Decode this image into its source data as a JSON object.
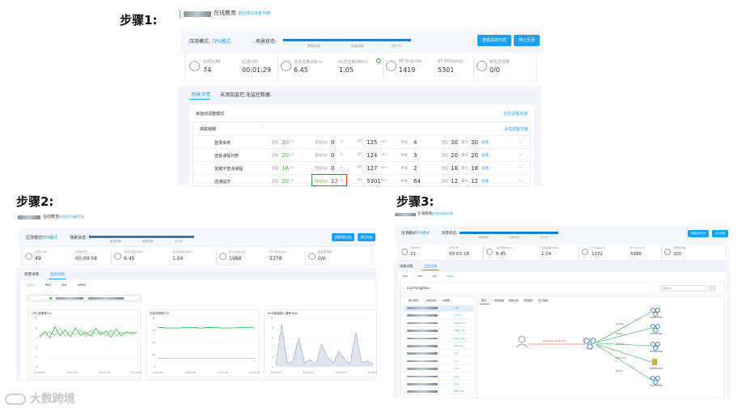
{
  "steps": {
    "s1": "步骤1:",
    "s2": "步骤2:",
    "s3": "步骤3:"
  },
  "header": {
    "title": "在线教育",
    "link": "返回测试场景列表"
  },
  "test": {
    "mode_label": "压测模式:",
    "mode_value": "TPS模式",
    "status_label": "场景状态:",
    "phases": [
      "数据准备",
      "链路调配",
      "执行中"
    ]
  },
  "buttons": {
    "log": "查看采样日志",
    "stop": "停止压测"
  },
  "metrics": {
    "s1": [
      {
        "label": "实时VUM",
        "value": "74"
      },
      {
        "label": "压测计时",
        "value": "00:01:29"
      },
      {
        "label": "请求流量(KB/s)",
        "value": "6.45"
      },
      {
        "label": "出流流量(MB/s)",
        "value": "1.05"
      },
      {
        "label": "RT Avg(ms)",
        "value": "1419"
      },
      {
        "label": "RT 90%(ms)",
        "value": "5301"
      },
      {
        "label": "新告异常数",
        "value": "0/0"
      }
    ],
    "s2": [
      {
        "label": "实时VUM",
        "value": "49"
      },
      {
        "label": "压测计时",
        "value": "00:00:58"
      },
      {
        "label": "请求流量(KB/s)",
        "value": "6.45"
      },
      {
        "label": "出流流量(MB/s)",
        "value": "1.04"
      },
      {
        "label": "RT Avg(ms)",
        "value": "1986"
      },
      {
        "label": "RT 90%(ms)",
        "value": "5378"
      },
      {
        "label": "新告异常数",
        "value": "0/0"
      }
    ],
    "s3": [
      {
        "label": "实时VUM",
        "value": "21"
      },
      {
        "label": "压测计时",
        "value": "00:03:18"
      },
      {
        "label": "请求流量(KB/s)",
        "value": "6.45"
      },
      {
        "label": "出流流量(MB/s)",
        "value": "1.04"
      },
      {
        "label": "RT Avg(ms)",
        "value": "1372"
      },
      {
        "label": "RT 90%(ms)",
        "value": "5380"
      },
      {
        "label": "新告异常数",
        "value": "0/0"
      }
    ]
  },
  "tabs1": {
    "details": "场景详情",
    "monitor": "未添加监控,无监控数据"
  },
  "section1": {
    "mode": "串自动调整模式",
    "global_link": "全局调整流速",
    "chain": "串联链路",
    "chain_link": "添加调整流速"
  },
  "rows": [
    {
      "name": "登录系统",
      "tps": "30",
      "err": "0",
      "rt": "125",
      "conc": "4",
      "now": "30",
      "max": "30",
      "act": "调速"
    },
    {
      "name": "查看课程列表",
      "tps": "20",
      "err": "0",
      "rt": "124",
      "conc": "3",
      "now": "20",
      "max": "20",
      "act": "调速"
    },
    {
      "name": "关键字查询课程",
      "tps": "18",
      "err": "0",
      "rt": "127",
      "conc": "2",
      "now": "18",
      "max": "18",
      "act": "调速"
    },
    {
      "name": "选课提交",
      "tps": "20",
      "err": "12",
      "rt": "5301",
      "conc": "64",
      "now": "12",
      "max": "12",
      "act": "调速"
    }
  ],
  "rowlabels": {
    "tps": "当前",
    "err": "错误tps",
    "rt": "RT",
    "conc": "并发",
    "now": "当前",
    "max": "最大",
    "unit_s": "/s",
    "unit_ms": "ms"
  },
  "tabs2": {
    "details": "场景详情",
    "monitor": "监控详情"
  },
  "subtabs2": [
    "ECS",
    "RDS",
    "SLB",
    "ARMS"
  ],
  "charts2": [
    {
      "title": "CPU 使用率(%)"
    },
    {
      "title": "内存利用率(%)"
    },
    {
      "title": "ph中磁盘读入速率 Bps"
    }
  ],
  "chart_data": [
    {
      "type": "line",
      "title": "CPU 使用率(%)",
      "x": [
        "14:38:00",
        "14:44:00",
        "14:50:00",
        "15:00:00"
      ],
      "ylim": [
        0,
        10
      ],
      "yticks": [
        "10",
        "8",
        "6",
        "4",
        "2",
        "0"
      ],
      "series": [
        {
          "values": [
            6.1,
            7.3,
            6.0,
            8.2,
            6.4,
            7.6,
            6.2,
            8.0,
            6.5,
            7.1,
            6.3,
            7.9,
            6.6,
            7.4,
            6.1,
            7.8,
            6.4,
            7.2,
            6.8,
            7.0
          ]
        },
        {
          "values": [
            6.4,
            6.8,
            7.2,
            6.5,
            7.9,
            6.3,
            7.4,
            6.6,
            7.7,
            6.2,
            7.5,
            6.7,
            7.3,
            6.4,
            7.6,
            6.5,
            7.1,
            6.8,
            7.2,
            6.9
          ]
        }
      ]
    },
    {
      "type": "line",
      "title": "内存利用率(%)",
      "x": [
        "14:38:00",
        "14:44:00",
        "14:50:00",
        "15:00:00"
      ],
      "ylim": [
        0,
        80
      ],
      "yticks": [
        "80",
        "60",
        "40",
        "20",
        "0"
      ],
      "series": [
        {
          "values": [
            65,
            64,
            64,
            65,
            64,
            65,
            64,
            64,
            65,
            64
          ]
        },
        {
          "values": [
            14,
            14,
            14,
            14,
            14,
            14,
            14,
            14,
            14,
            14
          ]
        }
      ]
    },
    {
      "type": "area",
      "title": "ph中磁盘读入速率 Bps",
      "x": [
        "14:38:00",
        "14:44:00",
        "14:50:00",
        "15:00:00"
      ],
      "ylim": [
        0,
        10
      ],
      "yticks": [
        "10",
        "8",
        "6",
        "4",
        "2",
        "0"
      ],
      "series": [
        {
          "values": [
            0.5,
            8.8,
            0.6,
            1.2,
            5.9,
            0.8,
            1.5,
            0.4,
            4.6,
            2.1,
            0.7,
            3.2,
            1.6,
            0.5,
            7.1,
            0.9,
            1.2,
            0.6
          ]
        }
      ]
    }
  ],
  "s3view": {
    "tabs": [
      "场景详情",
      "监控详情"
    ],
    "subtabs": [
      "ECS",
      "RDS",
      "SLB",
      "ARMS"
    ],
    "app": "jo-hangzhou",
    "search": "查询URL",
    "filter_tabs": [
      "默认排序",
      "响应时间",
      "请求数"
    ],
    "right_tabs": [
      "概览",
      "调用链路",
      "依赖关系",
      "调用拓扑",
      "接口快照"
    ],
    "list_values": [
      "1.1s",
      "737ms",
      "1065.3ms",
      "1082.7ms",
      "1090.0ms",
      "1093ms",
      "1.5s",
      "1.1s",
      "1.1s",
      "1.2s",
      "1.2s",
      "835.1ms"
    ],
    "edge_main": "1265.1ms / 8.35k TPS",
    "edge_labels": [
      "120.8ms",
      "5.98ms",
      "112.1ms",
      "1265.1ms",
      "8.29ms"
    ]
  },
  "watermark": "大数跨境"
}
